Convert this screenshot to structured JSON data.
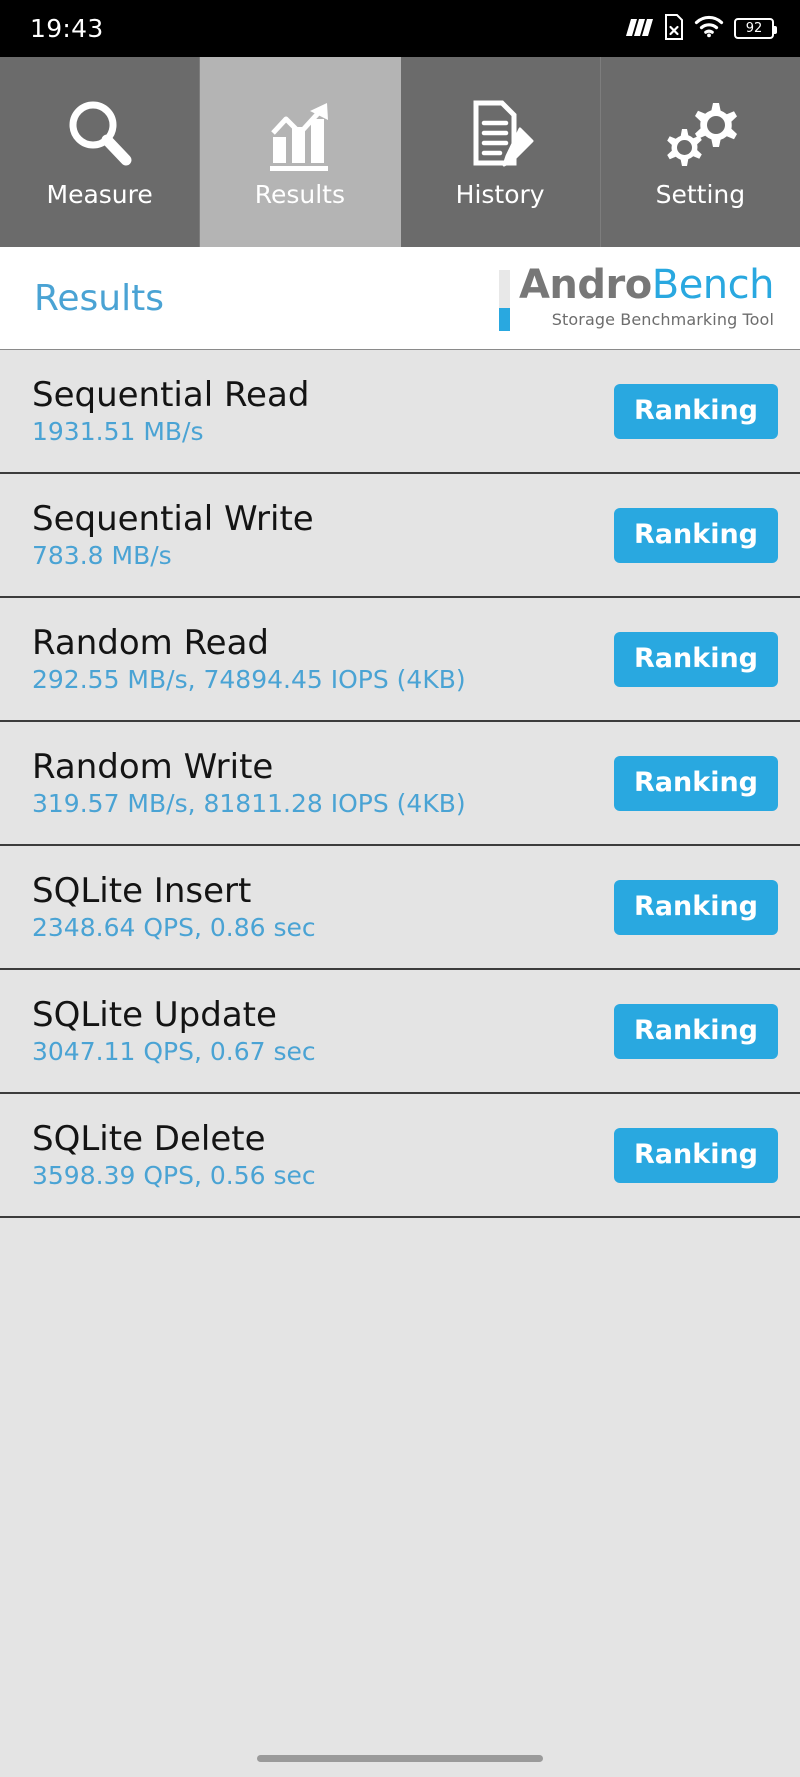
{
  "status_bar": {
    "time": "19:43",
    "icons": [
      "signal-icon",
      "sim-card-off-icon",
      "wifi-icon",
      "battery-icon"
    ],
    "battery_level": "92"
  },
  "tabs": [
    {
      "label": "Measure",
      "icon": "magnifier-icon",
      "active": false
    },
    {
      "label": "Results",
      "icon": "bar-chart-icon",
      "active": true
    },
    {
      "label": "History",
      "icon": "document-pencil-icon",
      "active": false
    },
    {
      "label": "Setting",
      "icon": "gears-icon",
      "active": false
    }
  ],
  "header": {
    "page_title": "Results",
    "brand_first": "Andro",
    "brand_second": "Bench",
    "brand_subtitle": "Storage Benchmarking Tool"
  },
  "results": [
    {
      "title": "Sequential Read",
      "value": "1931.51 MB/s",
      "button": "Ranking"
    },
    {
      "title": "Sequential Write",
      "value": "783.8 MB/s",
      "button": "Ranking"
    },
    {
      "title": "Random Read",
      "value": "292.55 MB/s, 74894.45 IOPS (4KB)",
      "button": "Ranking"
    },
    {
      "title": "Random Write",
      "value": "319.57 MB/s, 81811.28 IOPS (4KB)",
      "button": "Ranking"
    },
    {
      "title": "SQLite Insert",
      "value": "2348.64 QPS, 0.86 sec",
      "button": "Ranking"
    },
    {
      "title": "SQLite Update",
      "value": "3047.11 QPS, 0.67 sec",
      "button": "Ranking"
    },
    {
      "title": "SQLite Delete",
      "value": "3598.39 QPS, 0.56 sec",
      "button": "Ranking"
    }
  ],
  "colors": {
    "accent_blue": "#29a8e0",
    "value_blue": "#4aa3d4",
    "tab_inactive": "#6b6b6b",
    "tab_active": "#b4b4b4",
    "list_bg": "#e4e4e4",
    "status_bg": "#000000"
  }
}
